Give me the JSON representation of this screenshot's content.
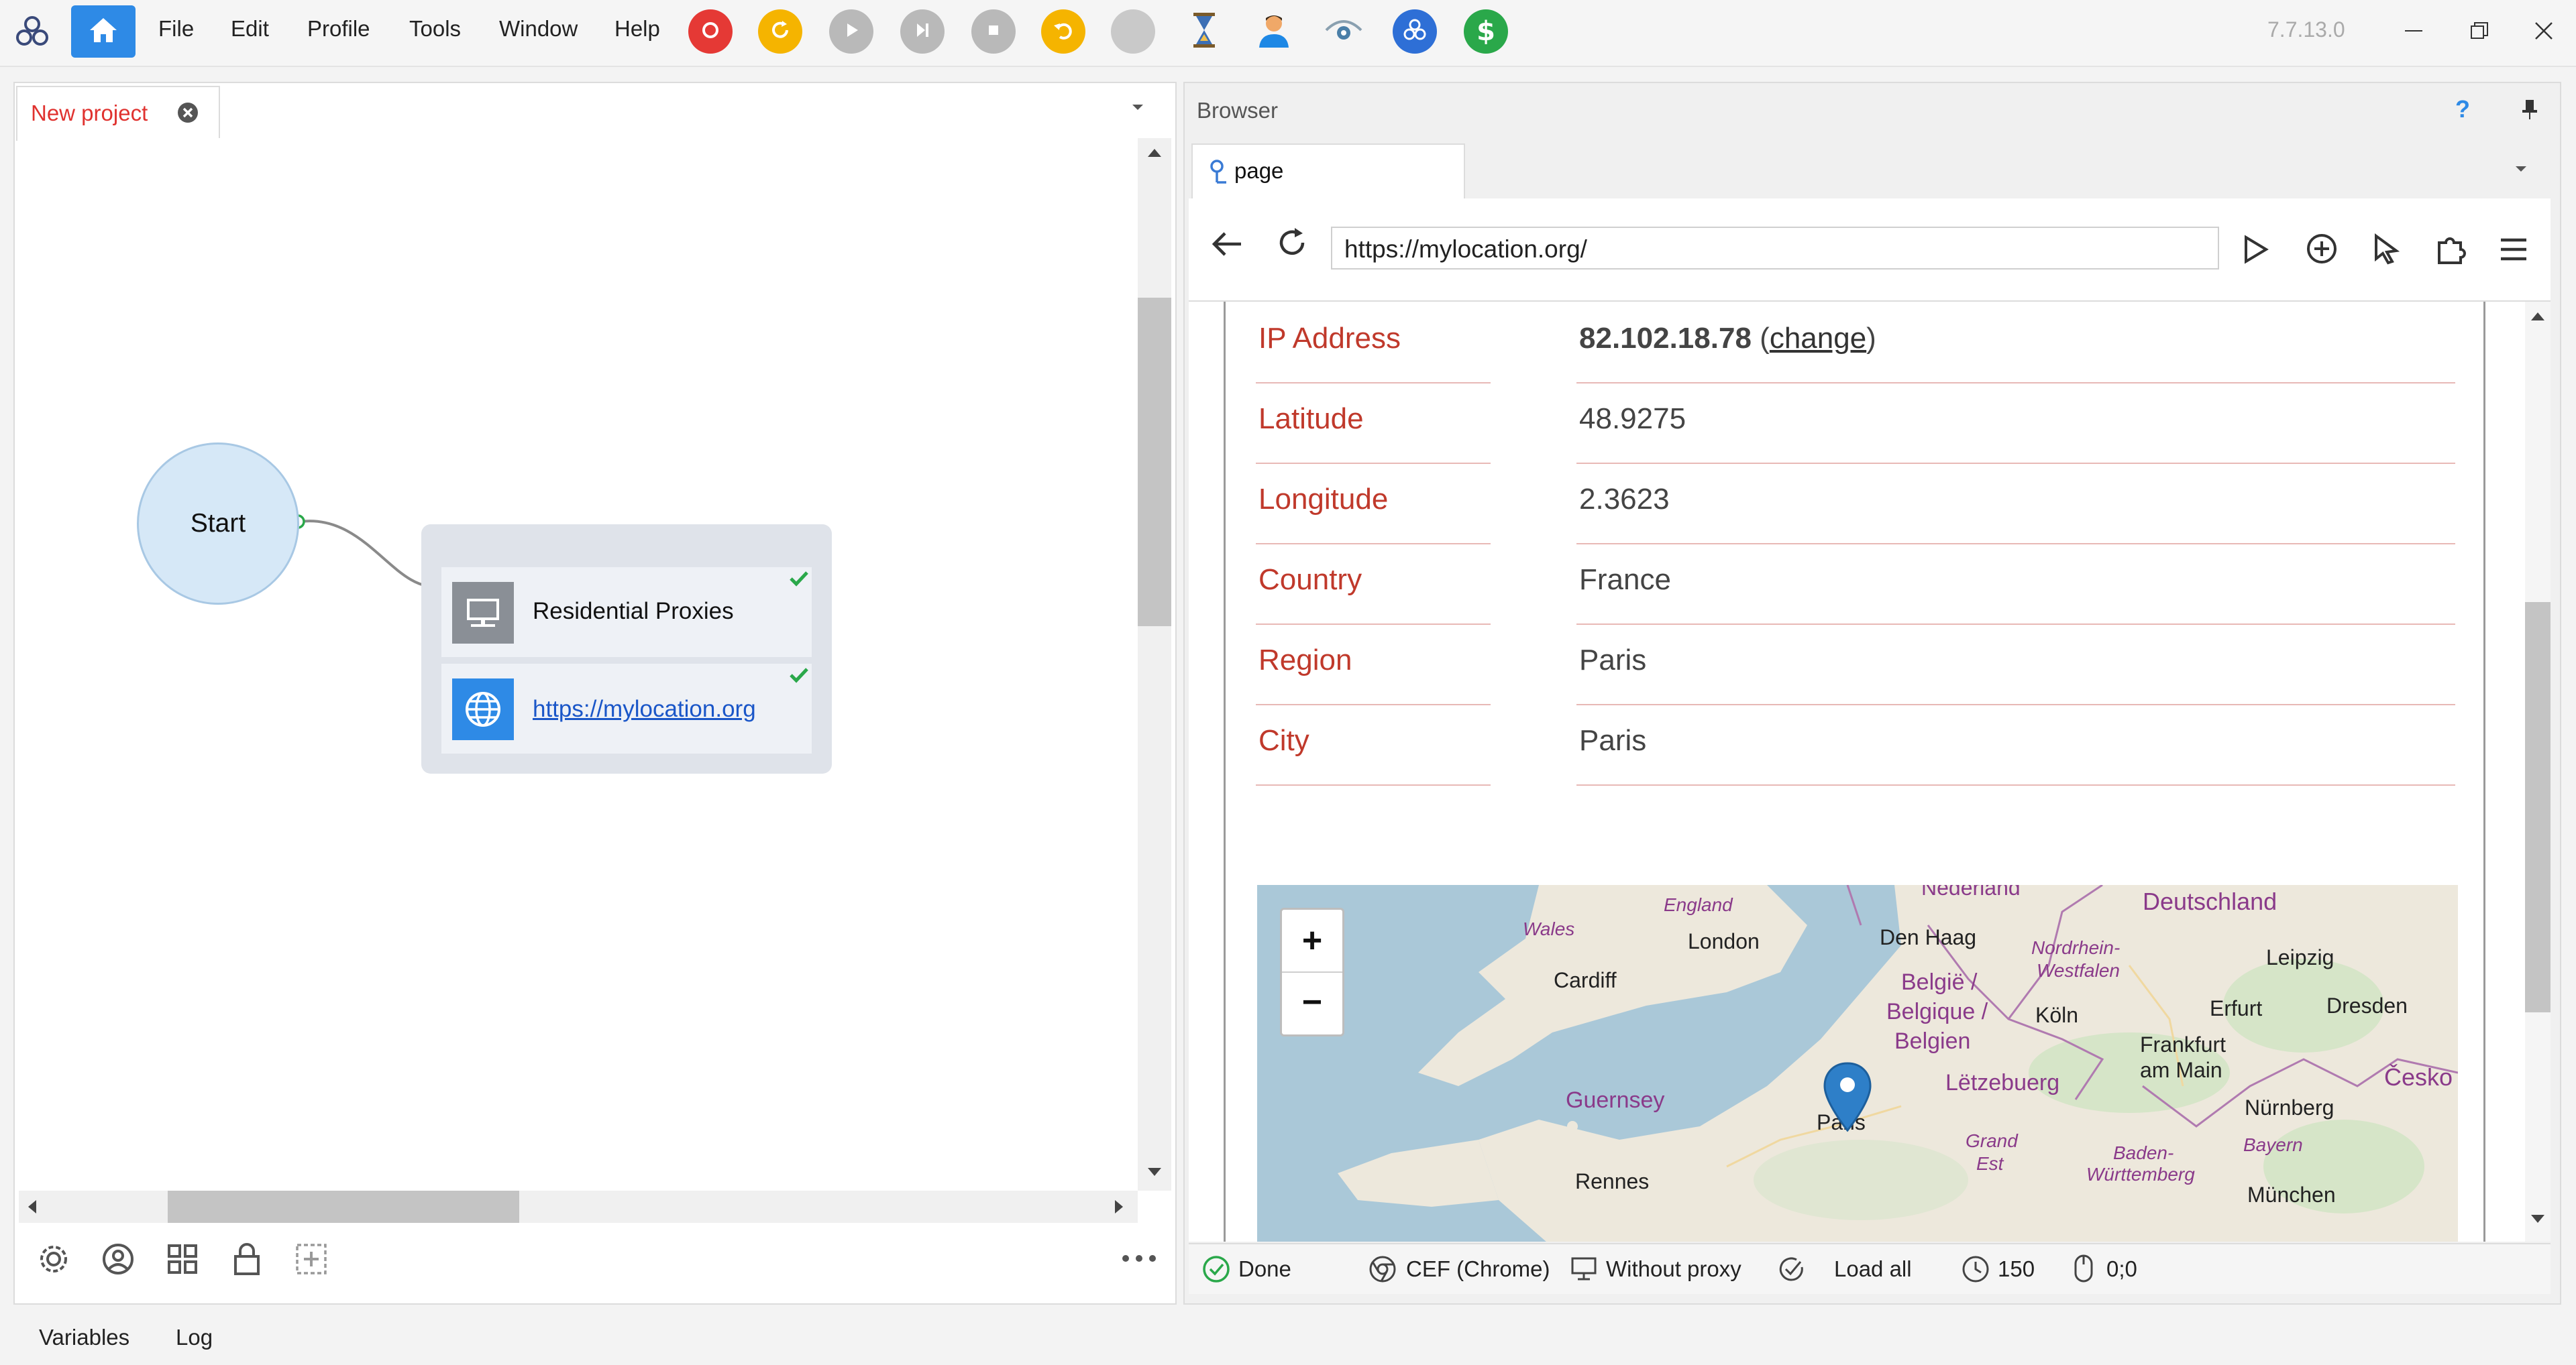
{
  "menu": {
    "file": "File",
    "edit": "Edit",
    "profile": "Profile",
    "tools": "Tools",
    "window": "Window",
    "help": "Help"
  },
  "version": "7.7.13.0",
  "project_tab": {
    "label": "New project"
  },
  "flow": {
    "start_label": "Start",
    "node_title": "Residential Proxies",
    "node_link": "https://mylocation.org"
  },
  "bottom_tabs": {
    "variables": "Variables",
    "log": "Log"
  },
  "browser": {
    "panel_title": "Browser",
    "help_glyph": "?",
    "page_tab": "page",
    "url": "https://mylocation.org/",
    "info": {
      "ip_label": "IP Address",
      "ip_value": "82.102.18.78",
      "ip_change": "change",
      "lat_label": "Latitude",
      "lat_value": "48.9275",
      "lon_label": "Longitude",
      "lon_value": "2.3623",
      "country_label": "Country",
      "country_value": "France",
      "region_label": "Region",
      "region_value": "Paris",
      "city_label": "City",
      "city_value": "Paris"
    },
    "map": {
      "zoom_in": "+",
      "zoom_out": "−",
      "labels": {
        "nederland": "Nederland",
        "deutschland": "Deutschland",
        "england": "England",
        "wales": "Wales",
        "london": "London",
        "den_haag": "Den Haag",
        "nordrhein": "Nordrhein-",
        "westfalen": "Westfalen",
        "leipzig": "Leipzig",
        "cardiff": "Cardiff",
        "belgie": "België /",
        "belgique": "Belgique /",
        "belgien": "Belgien",
        "koln": "Köln",
        "erfurt": "Erfurt",
        "dresden": "Dresden",
        "frankfurt": "Frankfurt",
        "am_main": "am Main",
        "cesko": "Česko",
        "letzebuerg": "Lëtzebuerg",
        "guernsey": "Guernsey",
        "paris": "Paris",
        "nurnberg": "Nürnberg",
        "grand": "Grand",
        "est": "Est",
        "bayern": "Bayern",
        "baden": "Baden-",
        "wurttemberg": "Württemberg",
        "rennes": "Rennes",
        "munchen": "München"
      }
    }
  },
  "status": {
    "done": "Done",
    "engine": "CEF (Chrome)",
    "proxy": "Without proxy",
    "load": "Load all",
    "timeout": "150",
    "coords": "0;0"
  },
  "colors": {
    "accent_blue": "#2e8ae6",
    "label_red": "#c0392b",
    "tab_red": "#e0322f",
    "check_green": "#2aa84a"
  }
}
